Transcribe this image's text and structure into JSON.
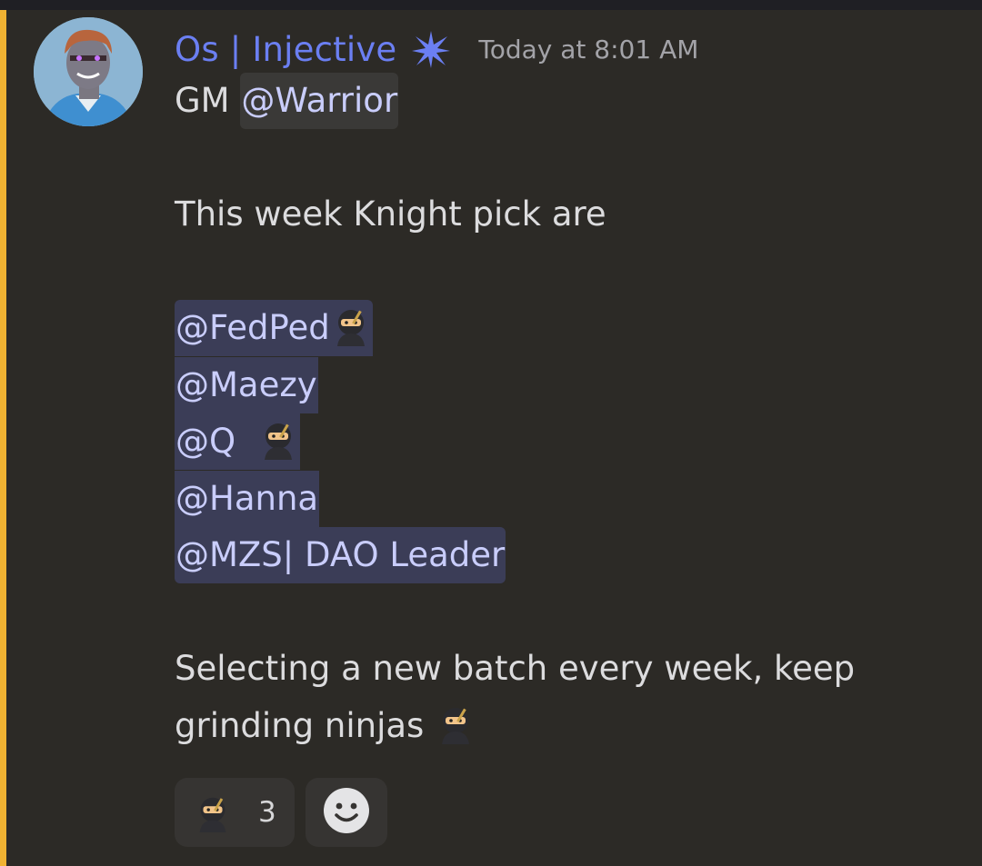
{
  "message": {
    "author": "Os | Injective",
    "timestamp": "Today at 8:01 AM",
    "badge_icon": "sparkle-badge-icon",
    "line1_prefix": "GM ",
    "line1_mention": "@Warrior",
    "line2": "This week Knight pick are",
    "mentions": [
      "@FedPed",
      "@Maezy",
      "@Q",
      "@Hanna",
      "@MZS| DAO Leader"
    ],
    "closing_line1": "Selecting a new batch every week, keep",
    "closing_line2": "grinding ninjas"
  },
  "reactions": [
    {
      "emoji": "ninja-emoji-icon",
      "count": "3"
    }
  ],
  "add_reaction_icon": "smiley-icon",
  "colors": {
    "accent_bar": "#f0b232",
    "username": "#6b7ff2",
    "mention_bg": "#3b3d57",
    "mention_text": "#c9cdfb",
    "background": "#2c2a26"
  }
}
